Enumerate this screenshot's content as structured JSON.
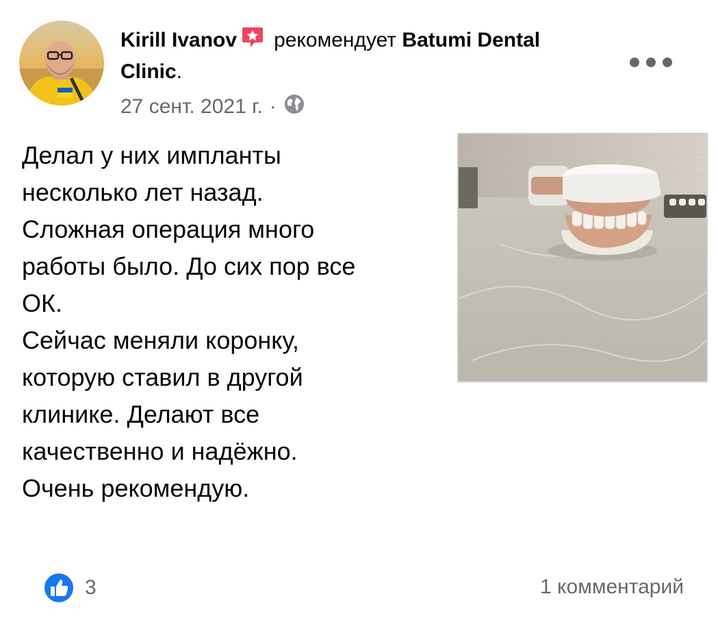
{
  "post": {
    "author": "Kirill Ivanov",
    "verb": "рекомендует",
    "page_name": "Batumi Dental Clinic",
    "page_suffix": ".",
    "date": "27 сент. 2021 г.",
    "separator": "·",
    "audience_icon": "globe-icon",
    "text": "Делал у них импланты\nнесколько лет назад.\nСложная операция много\nработы было. До сих пор все\nОК.\nСейчас меняли коронку,\nкоторую ставил в другой\nклинике. Делают все\nкачественно и надёжно.\nОчень рекомендую.",
    "photo_icon": "dental-model-photo"
  },
  "footer": {
    "reaction_icon": "like-icon",
    "reaction_count": "3",
    "comments": "1 комментарий"
  },
  "colors": {
    "text": "#050505",
    "secondary": "#65676b",
    "like_blue": "#1877f2",
    "recommend_red": "#f3425f"
  }
}
